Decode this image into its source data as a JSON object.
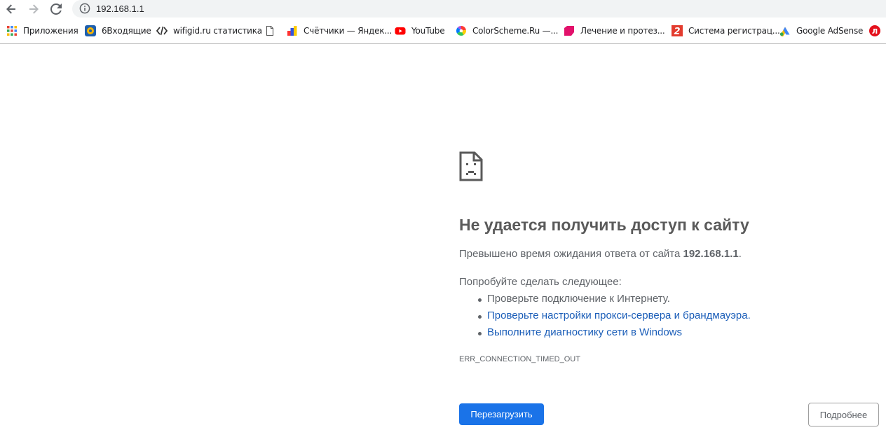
{
  "address_bar": {
    "url": "192.168.1.1"
  },
  "bookmarks": [
    {
      "label": "Приложения",
      "icon": "apps-grid-icon"
    },
    {
      "label": "6Входящие",
      "icon": "mail-at-icon"
    },
    {
      "label": "wifigid.ru  статистика",
      "icon": "code-tag-icon"
    },
    {
      "label": "Счётчики — Яндек...",
      "icon": "document-icon"
    },
    {
      "label": "YouTube",
      "icon": "youtube-icon"
    },
    {
      "label": "ColorScheme.Ru —...",
      "icon": "color-wheel-icon"
    },
    {
      "label": "Лечение и протез...",
      "icon": "pink-shape-icon"
    },
    {
      "label": "Система регистрац...",
      "icon": "red-two-icon"
    },
    {
      "label": "Google AdSense",
      "icon": "adsense-icon"
    },
    {
      "label": "",
      "icon": "red-l-icon"
    }
  ],
  "error": {
    "title": "Не удается получить доступ к сайту",
    "desc_prefix": "Превышено время ожидания ответа от сайта ",
    "desc_host": "192.168.1.1",
    "desc_suffix": ".",
    "try_title": "Попробуйте сделать следующее:",
    "suggestions": [
      "Проверьте подключение к Интернету.",
      "Проверьте настройки прокси-сервера и брандмауэра.",
      "Выполните диагностику сети в Windows"
    ],
    "code": "ERR_CONNECTION_TIMED_OUT",
    "reload_label": "Перезагрузить",
    "details_label": "Подробнее"
  },
  "colors": {
    "primary_button": "#1a73e8",
    "link": "#1a5db8",
    "title": "#5a5a5a",
    "text": "#5f6368"
  }
}
